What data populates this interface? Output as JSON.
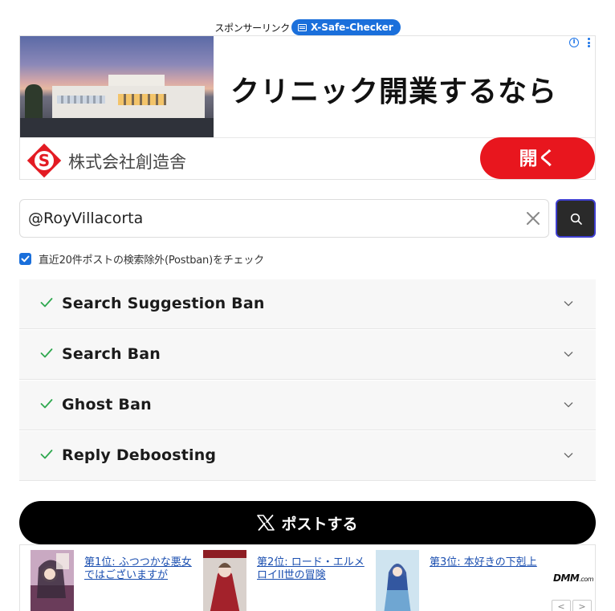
{
  "sponsor": {
    "label": "スポンサーリンク",
    "badge": "X-Safe-Checker"
  },
  "ad": {
    "headline": "クリニック開業するなら",
    "company": "株式会社創造舎",
    "open_label": "開く",
    "info_label": "i"
  },
  "search": {
    "value": "@RoyVillacorta",
    "placeholder": "@RoyVillacorta"
  },
  "option": {
    "checked": true,
    "label": "直近20件ポストの検索除外(Postban)をチェック"
  },
  "checks": [
    {
      "label": "Search Suggestion Ban",
      "status": "ok"
    },
    {
      "label": "Search Ban",
      "status": "ok"
    },
    {
      "label": "Ghost Ban",
      "status": "ok"
    },
    {
      "label": "Reply Deboosting",
      "status": "ok"
    }
  ],
  "post": {
    "label": "ポストする",
    "icon": "x-logo-icon"
  },
  "promo": {
    "items": [
      {
        "title": "第1位: ふつつかな悪女ではございますが"
      },
      {
        "title": "第2位: ロード・エルメロイII世の冒険"
      },
      {
        "title": "第3位: 本好きの下剋上"
      }
    ],
    "brand": "DMM",
    "brand_suffix": ".com",
    "prev": "<",
    "next": ">"
  },
  "colors": {
    "accent": "#1a6fdb",
    "ad_button": "#e8161e",
    "check": "#2fa84f",
    "post_button": "#000000"
  }
}
